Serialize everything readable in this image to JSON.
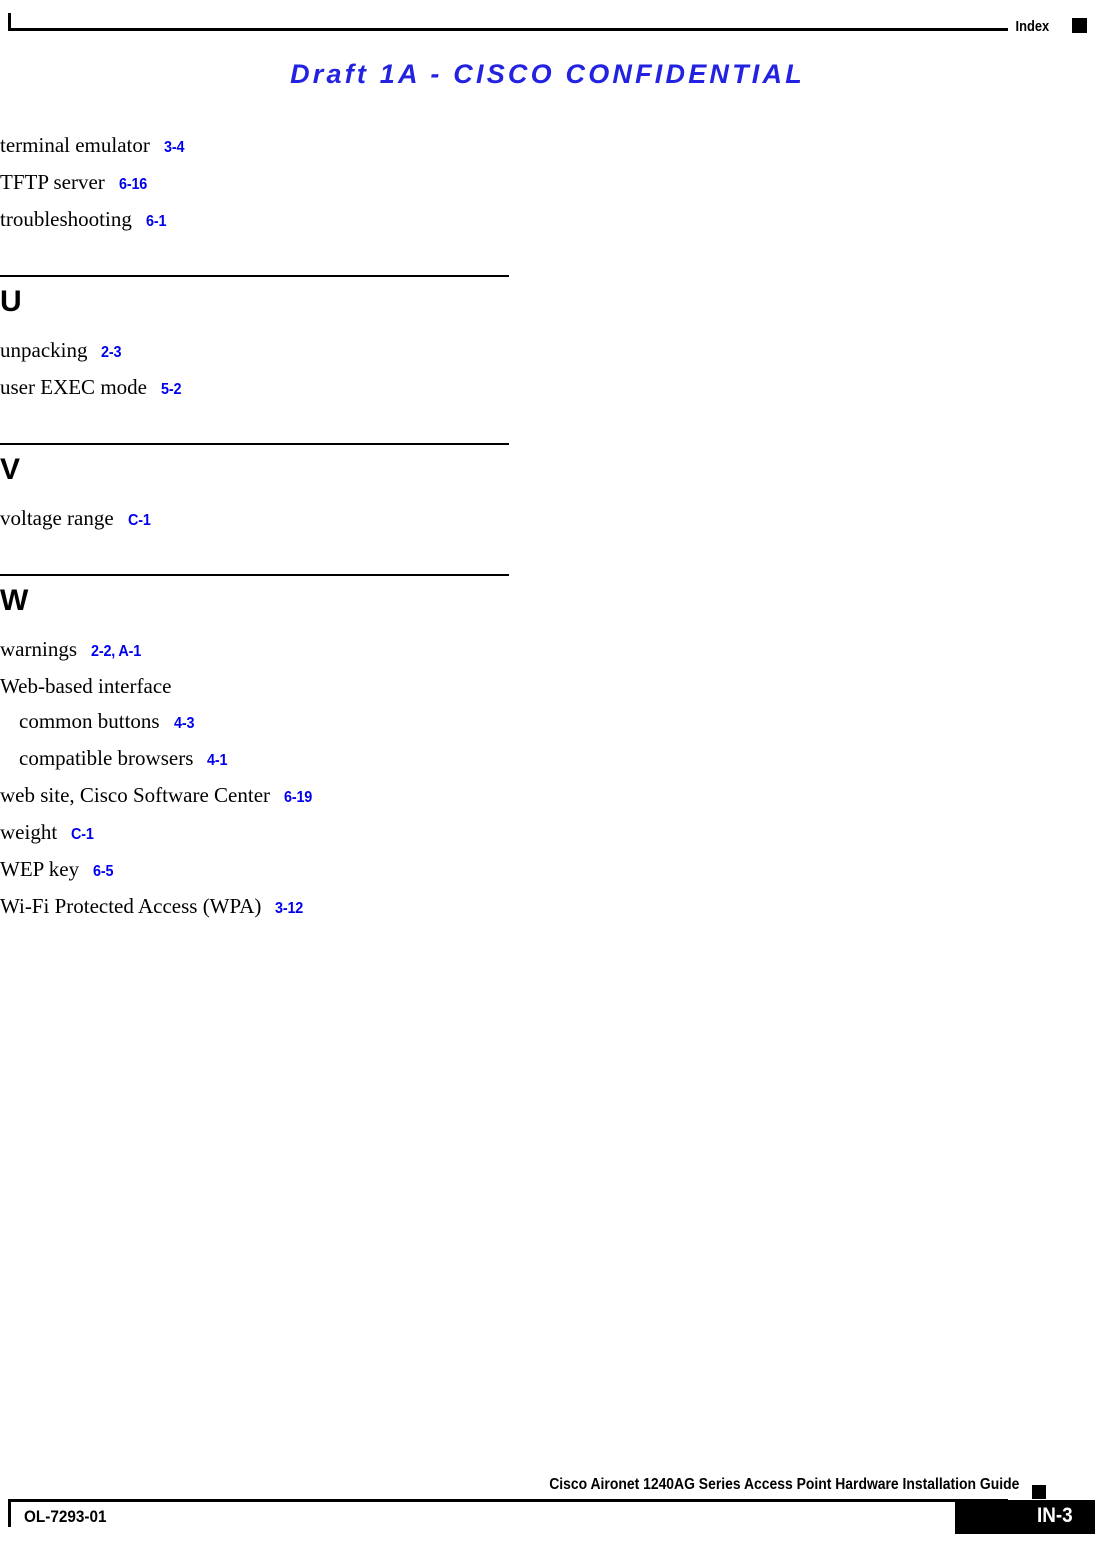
{
  "header": {
    "label": "Index",
    "marker_color": "#000000"
  },
  "draft_banner": {
    "text": "Draft 1A - CISCO CONFIDENTIAL",
    "color": "#2222e0"
  },
  "index": {
    "ref_color": "#0000ee",
    "continued_entries": [
      {
        "term": "terminal emulator",
        "refs": "3-4",
        "level": 0
      },
      {
        "term": "TFTP server",
        "refs": "6-16",
        "level": 0
      },
      {
        "term": "troubleshooting",
        "refs": "6-1",
        "level": 0
      }
    ],
    "sections": [
      {
        "letter": "U",
        "entries": [
          {
            "term": "unpacking",
            "refs": "2-3",
            "level": 0
          },
          {
            "term": "user EXEC mode",
            "refs": "5-2",
            "level": 0
          }
        ]
      },
      {
        "letter": "V",
        "entries": [
          {
            "term": "voltage range",
            "refs": "C-1",
            "level": 0
          }
        ]
      },
      {
        "letter": "W",
        "entries": [
          {
            "term": "warnings",
            "refs": "2-2, A-1",
            "level": 0
          },
          {
            "term": "Web-based interface",
            "refs": "",
            "level": 0
          },
          {
            "term": "common buttons",
            "refs": "4-3",
            "level": 1
          },
          {
            "term": "compatible browsers",
            "refs": "4-1",
            "level": 1
          },
          {
            "term": "web site, Cisco Software Center",
            "refs": "6-19",
            "level": 0
          },
          {
            "term": "weight",
            "refs": "C-1",
            "level": 0
          },
          {
            "term": "WEP key",
            "refs": "6-5",
            "level": 0
          },
          {
            "term": "Wi-Fi Protected Access (WPA)",
            "refs": "3-12",
            "level": 0
          }
        ]
      }
    ]
  },
  "footer": {
    "title": "Cisco Aironet 1240AG Series Access Point Hardware Installation Guide",
    "doc_id": "OL-7293-01",
    "page_number": "IN-3",
    "page_box_color": "#000000"
  }
}
